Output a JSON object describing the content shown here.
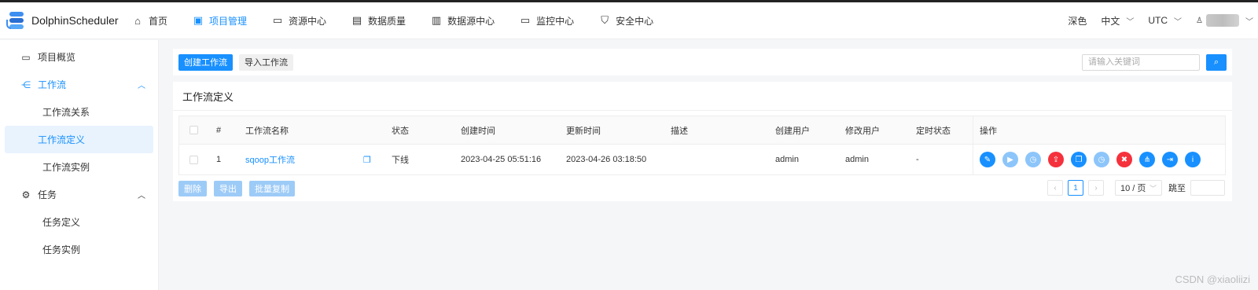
{
  "header": {
    "logo_text": "DolphinScheduler",
    "nav": [
      {
        "label": "首页",
        "icon": "home-icon",
        "glyph": "⌂"
      },
      {
        "label": "项目管理",
        "icon": "project-icon",
        "glyph": "▣",
        "active": true
      },
      {
        "label": "资源中心",
        "icon": "folder-icon",
        "glyph": "▭"
      },
      {
        "label": "数据质量",
        "icon": "checklist-icon",
        "glyph": "▤"
      },
      {
        "label": "数据源中心",
        "icon": "datasource-icon",
        "glyph": "▥"
      },
      {
        "label": "监控中心",
        "icon": "monitor-icon",
        "glyph": "▭"
      },
      {
        "label": "安全中心",
        "icon": "shield-icon",
        "glyph": "⛉"
      }
    ],
    "theme": "深色",
    "language": "中文",
    "timezone": "UTC"
  },
  "sidebar": {
    "overview": "项目概览",
    "workflow": {
      "label": "工作流",
      "children": [
        "工作流关系",
        "工作流定义",
        "工作流实例"
      ]
    },
    "task": {
      "label": "任务",
      "children": [
        "任务定义",
        "任务实例"
      ]
    }
  },
  "toolbar": {
    "create_label": "创建工作流",
    "import_label": "导入工作流",
    "search_placeholder": "请输入关键词"
  },
  "panel": {
    "title": "工作流定义",
    "columns": [
      "#",
      "工作流名称",
      "状态",
      "创建时间",
      "更新时间",
      "描述",
      "创建用户",
      "修改用户",
      "定时状态",
      "操作"
    ],
    "rows": [
      {
        "index": "1",
        "name": "sqoop工作流",
        "status": "下线",
        "created": "2023-04-25 05:51:16",
        "updated": "2023-04-26 03:18:50",
        "description": "",
        "creator": "admin",
        "modifier": "admin",
        "schedule": "-"
      }
    ],
    "bulk": {
      "delete": "删除",
      "export": "导出",
      "batch_copy": "批量复制"
    },
    "pager": {
      "current": "1",
      "page_size": "10 / 页",
      "jump_label": "跳至"
    }
  },
  "ops_icons": [
    {
      "name": "edit-icon",
      "glyph": "✎",
      "color": "blue"
    },
    {
      "name": "run-icon",
      "glyph": "▶",
      "color": "light"
    },
    {
      "name": "timing-icon",
      "glyph": "◷",
      "color": "light"
    },
    {
      "name": "upload-icon",
      "glyph": "⇪",
      "color": "red"
    },
    {
      "name": "copy-icon",
      "glyph": "❐",
      "color": "blue"
    },
    {
      "name": "schedule-icon",
      "glyph": "◷",
      "color": "light"
    },
    {
      "name": "delete-icon",
      "glyph": "✖",
      "color": "red"
    },
    {
      "name": "tree-icon",
      "glyph": "⋔",
      "color": "blue"
    },
    {
      "name": "export-icon",
      "glyph": "⇥",
      "color": "blue"
    },
    {
      "name": "info-icon",
      "glyph": "i",
      "color": "blue"
    }
  ],
  "watermark": "CSDN @xiaoliizi"
}
